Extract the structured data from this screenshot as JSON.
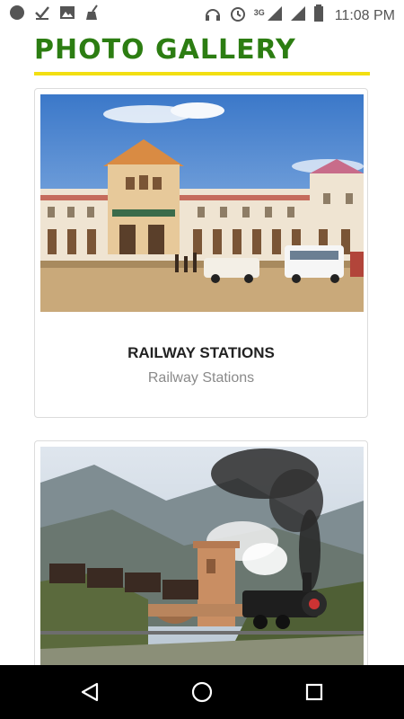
{
  "status_bar": {
    "time": "11:08 PM",
    "network": "3G",
    "icons_left": [
      "record-icon",
      "check-icon",
      "image-icon",
      "broom-icon"
    ],
    "icons_right": [
      "headphones-icon",
      "alarm-icon",
      "signal-icon",
      "signal-icon",
      "battery-icon"
    ]
  },
  "header": {
    "title": "PHOTO GALLERY",
    "title_color": "#2c7d12",
    "underline_color": "#f2df12"
  },
  "gallery": {
    "items": [
      {
        "title": "RAILWAY STATIONS",
        "subtitle": "Railway Stations",
        "image": "railway-station-photo"
      },
      {
        "title": "",
        "subtitle": "",
        "image": "steam-train-photo"
      }
    ]
  },
  "nav_bar": {
    "buttons": [
      "back-icon",
      "home-icon",
      "recents-icon"
    ]
  }
}
